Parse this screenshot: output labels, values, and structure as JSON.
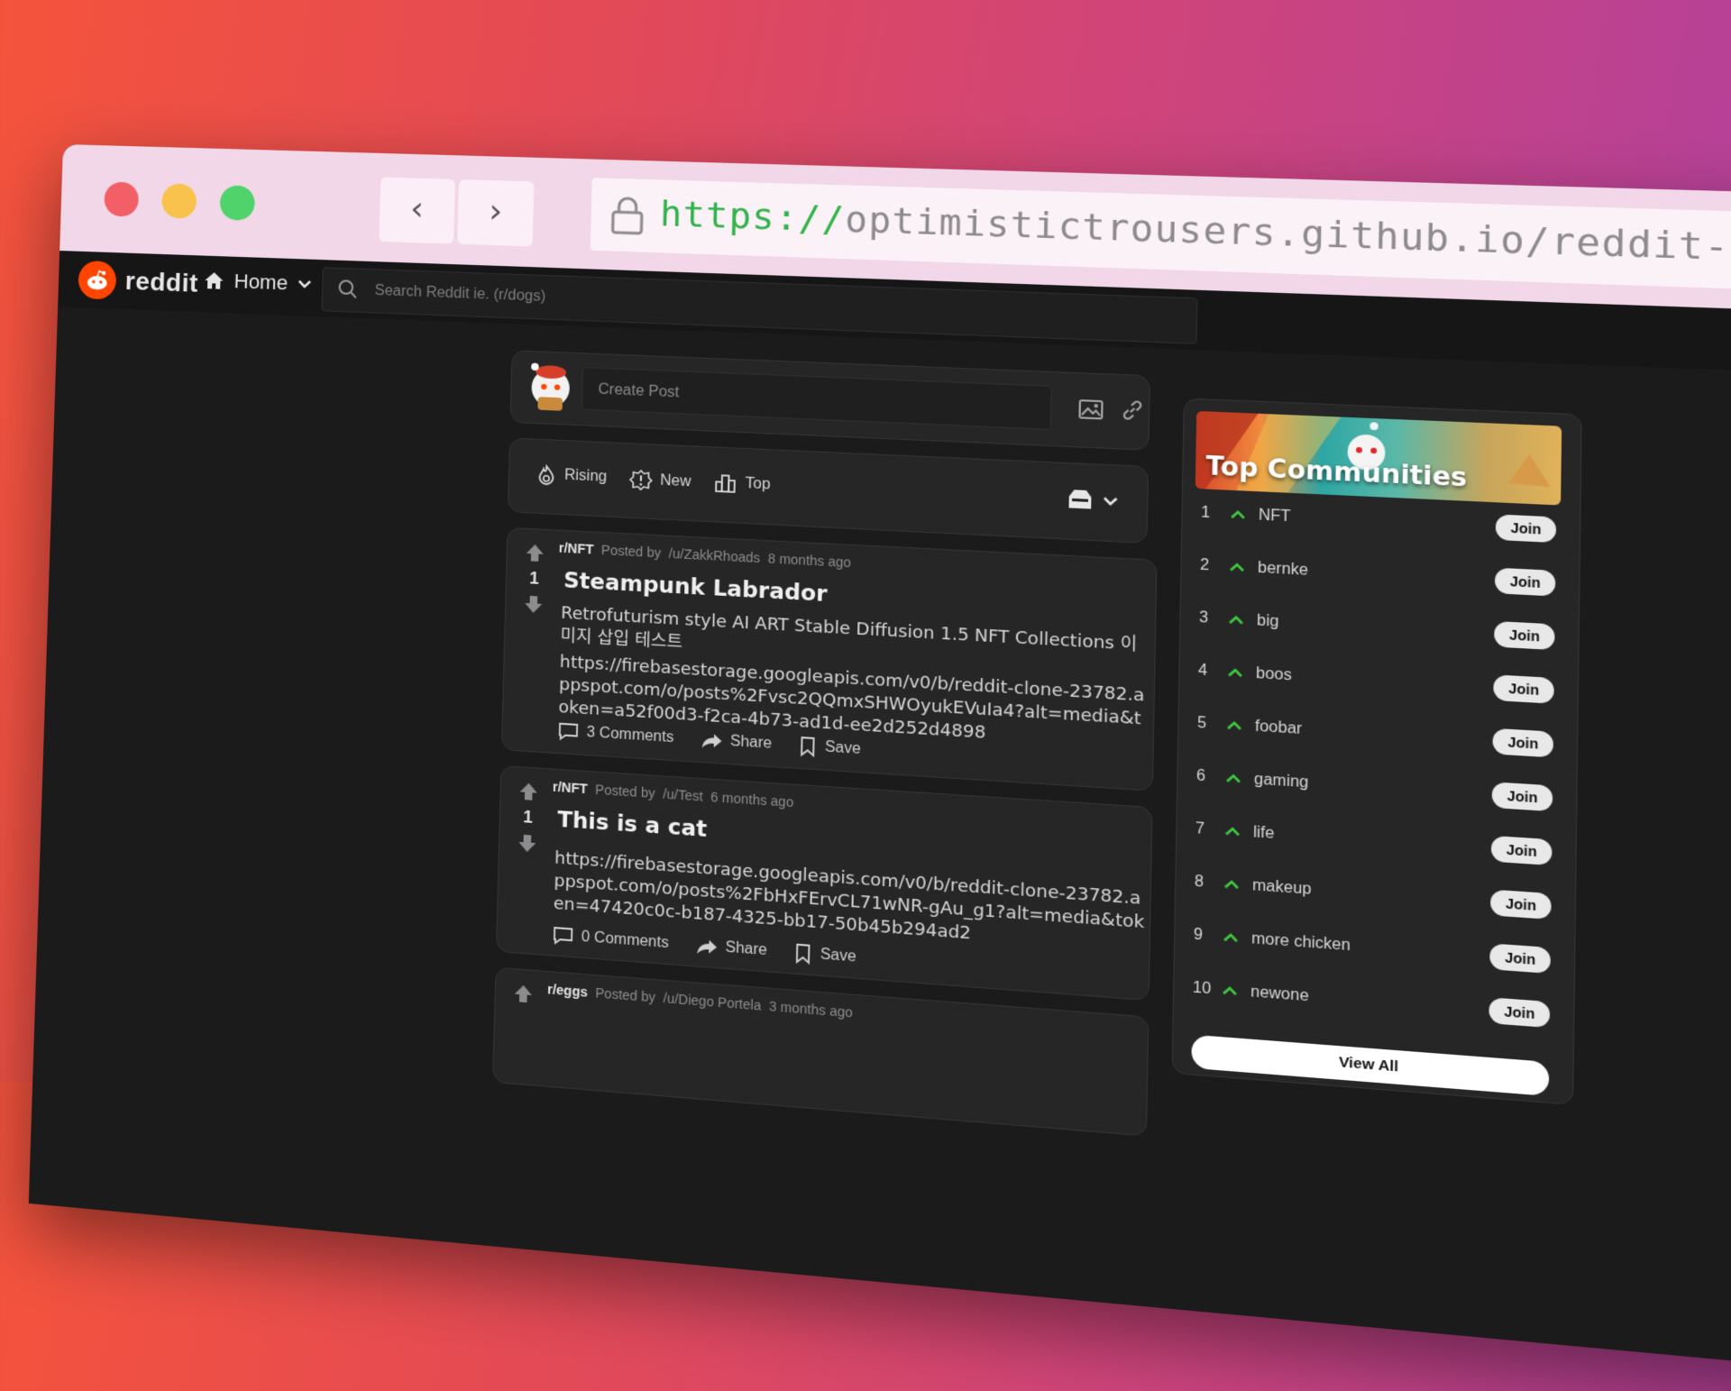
{
  "browser": {
    "url_scheme": "https://",
    "url_rest": "optimistictrousers.github.io/reddit-clone"
  },
  "app": {
    "logo_text": "reddit",
    "home_label": "Home",
    "search_placeholder": "Search Reddit ie. (r/dogs)",
    "create_post_placeholder": "Create Post",
    "sort_tabs": [
      "Rising",
      "New",
      "Top"
    ]
  },
  "posts": [
    {
      "subreddit": "r/NFT",
      "posted_by_label": "Posted by",
      "user": "/u/ZakkRhoads",
      "time": "8 months ago",
      "votes": "1",
      "title": "Steampunk Labrador",
      "text": "Retrofuturism style AI ART Stable Diffusion 1.5 NFT Collections 이미지 삽입 테스트",
      "link": "https://firebasestorage.googleapis.com/v0/b/reddit-clone-23782.appspot.com/o/posts%2Fvsc2QQmxSHWOyukEVuIa4?alt=media&token=a52f00d3-f2ca-4b73-ad1d-ee2d252d4898",
      "comments": "3 Comments",
      "share": "Share",
      "save": "Save"
    },
    {
      "subreddit": "r/NFT",
      "posted_by_label": "Posted by",
      "user": "/u/Test",
      "time": "6 months ago",
      "votes": "1",
      "title": "This is a cat",
      "text": "",
      "link": "https://firebasestorage.googleapis.com/v0/b/reddit-clone-23782.appspot.com/o/posts%2FbHxFErvCL71wNR-gAu_g1?alt=media&token=47420c0c-b187-4325-bb17-50b45b294ad2",
      "comments": "0 Comments",
      "share": "Share",
      "save": "Save"
    },
    {
      "subreddit": "r/eggs",
      "posted_by_label": "Posted by",
      "user": "/u/Diego Portela",
      "time": "3 months ago"
    }
  ],
  "sidebar": {
    "title": "Top Communities",
    "communities": [
      {
        "rank": "1",
        "name": "NFT",
        "join": "Join"
      },
      {
        "rank": "2",
        "name": "bernke",
        "join": "Join"
      },
      {
        "rank": "3",
        "name": "big",
        "join": "Join"
      },
      {
        "rank": "4",
        "name": "boos",
        "join": "Join"
      },
      {
        "rank": "5",
        "name": "foobar",
        "join": "Join"
      },
      {
        "rank": "6",
        "name": "gaming",
        "join": "Join"
      },
      {
        "rank": "7",
        "name": "life",
        "join": "Join"
      },
      {
        "rank": "8",
        "name": "makeup",
        "join": "Join"
      },
      {
        "rank": "9",
        "name": "more chicken",
        "join": "Join"
      },
      {
        "rank": "10",
        "name": "newone",
        "join": "Join"
      }
    ],
    "view_all": "View All"
  },
  "colors": {
    "accent_orange": "#ff4500",
    "upvote_green": "#3ec93e",
    "background": "#1b1b1c",
    "card": "#262627"
  }
}
